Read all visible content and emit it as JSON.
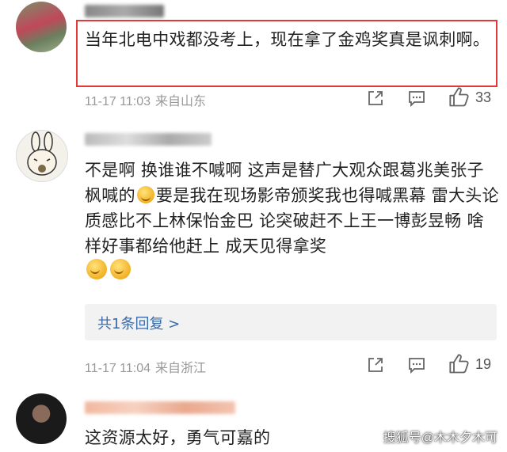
{
  "comments": [
    {
      "text": "当年北电中戏都没考上，现在拿了金鸡奖真是讽刺啊。",
      "time": "11-17 11:03",
      "location": "来自山东",
      "likes": "33"
    },
    {
      "text_part1": "不是啊 换谁谁不喊啊 这声是替广大观众跟葛兆美张子枫喊的",
      "text_part2": "要是我在现场影帝颁奖我也得喊黑幕 雷大头论质感比不上林保怡金巴 论突破赶不上王一博彭昱畅 啥样好事都给他赶上 成天见得拿奖",
      "replies_label": "共1条回复 >",
      "time": "11-17 11:04",
      "location": "来自浙江",
      "likes": "19"
    },
    {
      "text": "这资源太好，勇气可嘉的"
    }
  ],
  "icons": [
    "share-icon",
    "comment-icon",
    "thumbs-up-icon",
    "emoji-icon"
  ],
  "colors": {
    "highlight": "#e53935",
    "link": "#3a6aa8",
    "meta": "#999999"
  },
  "watermark": "搜狐号@木木夕木可"
}
